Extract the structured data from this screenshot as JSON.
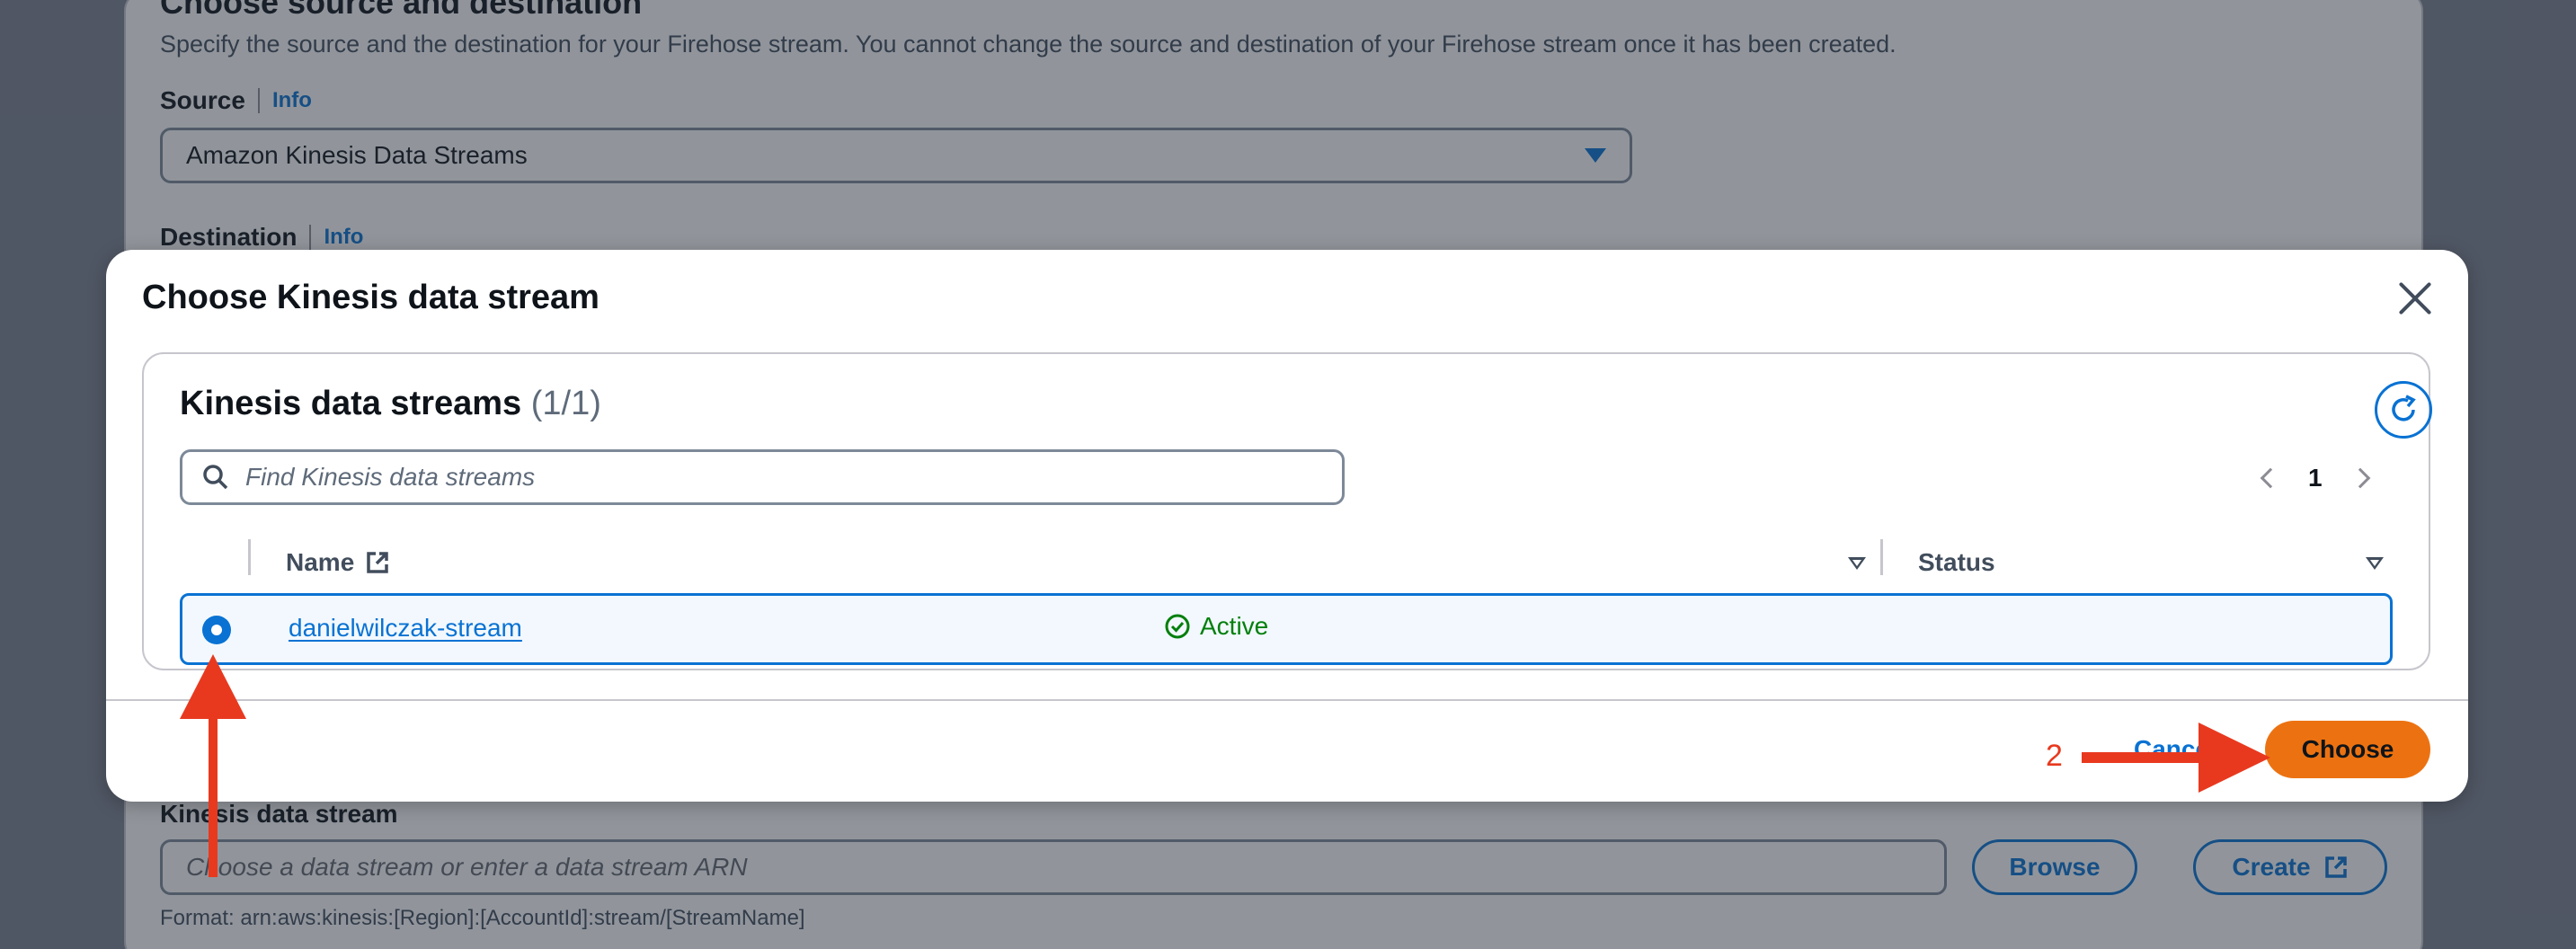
{
  "background": {
    "section_heading": "Choose source and destination",
    "section_desc": "Specify the source and the destination for your Firehose stream. You cannot change the source and destination of your Firehose stream once it has been created.",
    "source_label": "Source",
    "source_info": "Info",
    "source_value": "Amazon Kinesis Data Streams",
    "destination_label": "Destination",
    "destination_info": "Info",
    "stream_label": "Kinesis data stream",
    "stream_placeholder": "Choose a data stream or enter a data stream ARN",
    "browse_label": "Browse",
    "create_label": "Create",
    "format_hint": "Format: arn:aws:kinesis:[Region]:[AccountId]:stream/[StreamName]"
  },
  "modal": {
    "title": "Choose Kinesis data stream",
    "container_title": "Kinesis data streams",
    "container_count": "(1/1)",
    "search_placeholder": "Find Kinesis data streams",
    "page_number": "1",
    "columns": [
      "Name",
      "Status"
    ],
    "rows": [
      {
        "name": "danielwilczak-stream",
        "status": "Active",
        "selected": true
      }
    ],
    "cancel_label": "Cancel",
    "choose_label": "Choose"
  },
  "annotations": {
    "step_number": "2",
    "arrow_color": "#e8391f"
  },
  "colors": {
    "accent": "#0972d3",
    "primary_button": "#ec7211",
    "success": "#037f0c"
  }
}
